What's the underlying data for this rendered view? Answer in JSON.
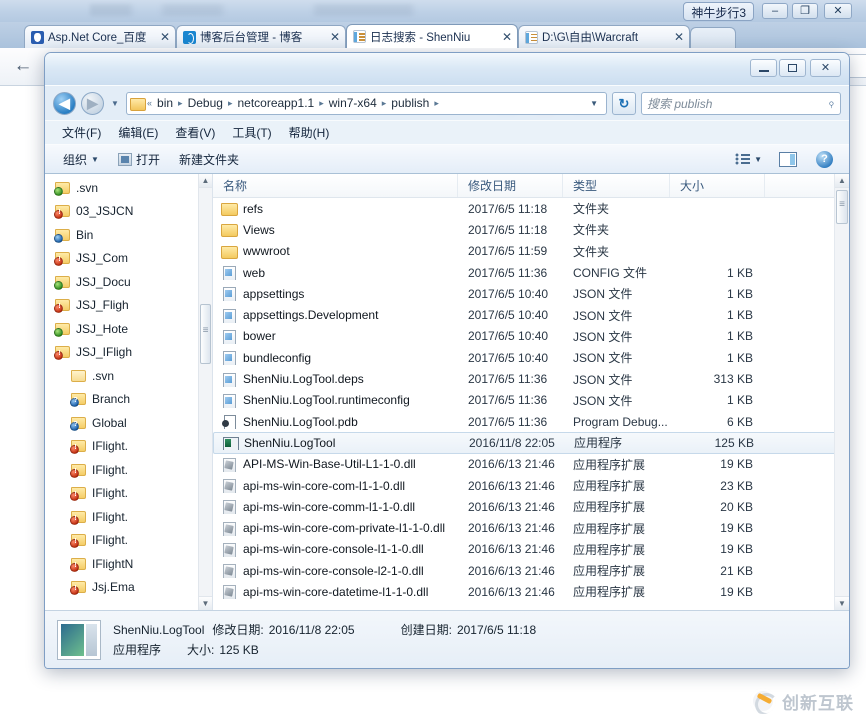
{
  "browser": {
    "window_label": "神牛步行3",
    "window_controls": {
      "minimize": "–",
      "maximize": "❐",
      "close": "✕"
    },
    "tabs": [
      {
        "label": "Asp.Net Core_百度",
        "favicon": "baidu-icon",
        "close": "✕",
        "active": false
      },
      {
        "label": "博客后台管理 - 博客",
        "favicon": "blog-icon",
        "close": "✕",
        "active": false
      },
      {
        "label": "日志搜索 - ShenNiu",
        "favicon": "document-icon",
        "close": "✕",
        "active": true
      },
      {
        "label": "D:\\G\\自由\\Warcraft",
        "favicon": "document-icon",
        "close": "✕",
        "active": false
      }
    ],
    "new_tab_label": "",
    "back_arrow": "←",
    "watermark": "创新互联"
  },
  "explorer": {
    "window_controls": {
      "minimize": "",
      "maximize": "",
      "close": "✕"
    },
    "address": {
      "back": "◀",
      "forward": "▶",
      "history_caret": "▼",
      "overflow": "«",
      "crumbs": [
        "bin",
        "Debug",
        "netcoreapp1.1",
        "win7-x64",
        "publish"
      ],
      "separator": "▸",
      "dropdown_caret": "▼",
      "refresh": "↻",
      "search_placeholder": "搜索 publish",
      "search_value": "",
      "search_icon": "🔍"
    },
    "menu": [
      "文件(F)",
      "编辑(E)",
      "查看(V)",
      "工具(T)",
      "帮助(H)"
    ],
    "toolbar": {
      "organize": "组织",
      "organize_caret": "▼",
      "open": "打开",
      "new_folder": "新建文件夹",
      "view_caret": "▼",
      "help_glyph": "?"
    },
    "nav_pane": {
      "scroll_up": "▲",
      "scroll_down": "▼",
      "items": [
        {
          "label": ".svn",
          "badge": "green",
          "indent": 1
        },
        {
          "label": "03_JSJCN",
          "badge": "red",
          "indent": 1
        },
        {
          "label": "Bin",
          "badge": "blue",
          "indent": 1
        },
        {
          "label": "JSJ_Com",
          "badge": "red",
          "indent": 1
        },
        {
          "label": "JSJ_Docu",
          "badge": "green",
          "indent": 1
        },
        {
          "label": "JSJ_Fligh",
          "badge": "red",
          "indent": 1
        },
        {
          "label": "JSJ_Hote",
          "badge": "green",
          "indent": 1
        },
        {
          "label": "JSJ_IFligh",
          "badge": "red",
          "indent": 1
        },
        {
          "label": ".svn",
          "badge": "none",
          "indent": 2
        },
        {
          "label": "Branch",
          "badge": "qmark",
          "indent": 2
        },
        {
          "label": "Global",
          "badge": "qmark",
          "indent": 2
        },
        {
          "label": "IFlight.",
          "badge": "red",
          "indent": 2
        },
        {
          "label": "IFlight.",
          "badge": "red",
          "indent": 2
        },
        {
          "label": "IFlight.",
          "badge": "red",
          "indent": 2
        },
        {
          "label": "IFlight.",
          "badge": "red",
          "indent": 2
        },
        {
          "label": "IFlight.",
          "badge": "red",
          "indent": 2
        },
        {
          "label": "IFlightN",
          "badge": "red",
          "indent": 2
        },
        {
          "label": "Jsj.Ema",
          "badge": "red",
          "indent": 2
        }
      ]
    },
    "file_list": {
      "columns": [
        "名称",
        "修改日期",
        "类型",
        "大小"
      ],
      "rows": [
        {
          "name": "refs",
          "date": "2017/6/5 11:18",
          "type": "文件夹",
          "size": "",
          "icon": "folder",
          "selected": false
        },
        {
          "name": "Views",
          "date": "2017/6/5 11:18",
          "type": "文件夹",
          "size": "",
          "icon": "folder",
          "selected": false
        },
        {
          "name": "wwwroot",
          "date": "2017/6/5 11:59",
          "type": "文件夹",
          "size": "",
          "icon": "folder",
          "selected": false
        },
        {
          "name": "web",
          "date": "2017/6/5 11:36",
          "type": "CONFIG 文件",
          "size": "1 KB",
          "icon": "doc",
          "selected": false
        },
        {
          "name": "appsettings",
          "date": "2017/6/5 10:40",
          "type": "JSON 文件",
          "size": "1 KB",
          "icon": "doc",
          "selected": false
        },
        {
          "name": "appsettings.Development",
          "date": "2017/6/5 10:40",
          "type": "JSON 文件",
          "size": "1 KB",
          "icon": "doc",
          "selected": false
        },
        {
          "name": "bower",
          "date": "2017/6/5 10:40",
          "type": "JSON 文件",
          "size": "1 KB",
          "icon": "doc",
          "selected": false
        },
        {
          "name": "bundleconfig",
          "date": "2017/6/5 10:40",
          "type": "JSON 文件",
          "size": "1 KB",
          "icon": "doc",
          "selected": false
        },
        {
          "name": "ShenNiu.LogTool.deps",
          "date": "2017/6/5 11:36",
          "type": "JSON 文件",
          "size": "313 KB",
          "icon": "doc",
          "selected": false
        },
        {
          "name": "ShenNiu.LogTool.runtimeconfig",
          "date": "2017/6/5 11:36",
          "type": "JSON 文件",
          "size": "1 KB",
          "icon": "doc",
          "selected": false
        },
        {
          "name": "ShenNiu.LogTool.pdb",
          "date": "2017/6/5 11:36",
          "type": "Program Debug...",
          "size": "6 KB",
          "icon": "pdb",
          "selected": false
        },
        {
          "name": "ShenNiu.LogTool",
          "date": "2016/11/8 22:05",
          "type": "应用程序",
          "size": "125 KB",
          "icon": "exe",
          "selected": true
        },
        {
          "name": "API-MS-Win-Base-Util-L1-1-0.dll",
          "date": "2016/6/13 21:46",
          "type": "应用程序扩展",
          "size": "19 KB",
          "icon": "dll",
          "selected": false
        },
        {
          "name": "api-ms-win-core-com-l1-1-0.dll",
          "date": "2016/6/13 21:46",
          "type": "应用程序扩展",
          "size": "23 KB",
          "icon": "dll",
          "selected": false
        },
        {
          "name": "api-ms-win-core-comm-l1-1-0.dll",
          "date": "2016/6/13 21:46",
          "type": "应用程序扩展",
          "size": "20 KB",
          "icon": "dll",
          "selected": false
        },
        {
          "name": "api-ms-win-core-com-private-l1-1-0.dll",
          "date": "2016/6/13 21:46",
          "type": "应用程序扩展",
          "size": "19 KB",
          "icon": "dll",
          "selected": false
        },
        {
          "name": "api-ms-win-core-console-l1-1-0.dll",
          "date": "2016/6/13 21:46",
          "type": "应用程序扩展",
          "size": "19 KB",
          "icon": "dll",
          "selected": false
        },
        {
          "name": "api-ms-win-core-console-l2-1-0.dll",
          "date": "2016/6/13 21:46",
          "type": "应用程序扩展",
          "size": "21 KB",
          "icon": "dll",
          "selected": false
        },
        {
          "name": "api-ms-win-core-datetime-l1-1-0.dll",
          "date": "2016/6/13 21:46",
          "type": "应用程序扩展",
          "size": "19 KB",
          "icon": "dll",
          "selected": false
        }
      ]
    },
    "status": {
      "name": "ShenNiu.LogTool",
      "modified_label": "修改日期:",
      "modified_value": "2016/11/8 22:05",
      "created_label": "创建日期:",
      "created_value": "2017/6/5 11:18",
      "type": "应用程序",
      "size_label": "大小:",
      "size_value": "125 KB"
    }
  }
}
